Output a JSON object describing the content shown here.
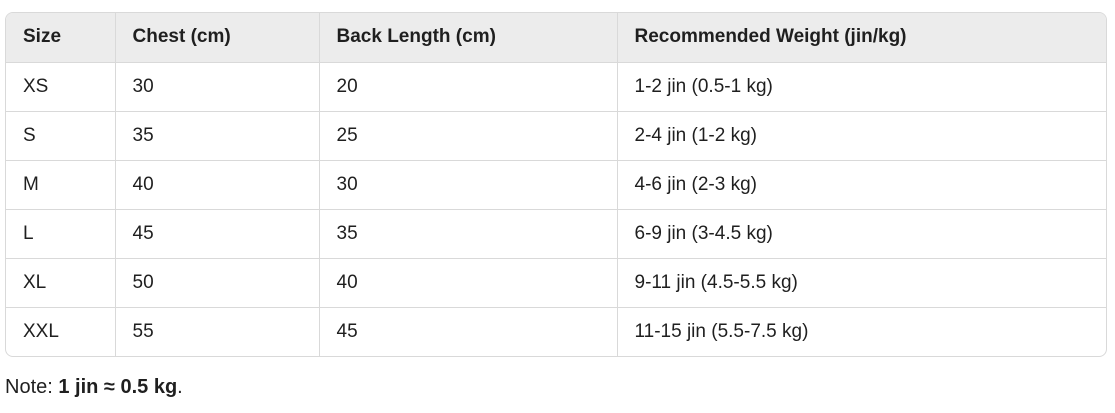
{
  "table": {
    "headers": [
      "Size",
      "Chest (cm)",
      "Back Length (cm)",
      "Recommended Weight (jin/kg)"
    ],
    "rows": [
      [
        "XS",
        "30",
        "20",
        "1-2 jin (0.5-1 kg)"
      ],
      [
        "S",
        "35",
        "25",
        "2-4 jin (1-2 kg)"
      ],
      [
        "M",
        "40",
        "30",
        "4-6 jin (2-3 kg)"
      ],
      [
        "L",
        "45",
        "35",
        "6-9 jin (3-4.5 kg)"
      ],
      [
        "XL",
        "50",
        "40",
        "9-11 jin (4.5-5.5 kg)"
      ],
      [
        "XXL",
        "55",
        "45",
        "11-15 jin (5.5-7.5 kg)"
      ]
    ]
  },
  "note": {
    "prefix": "Note: ",
    "emphasis": "1 jin ≈ 0.5 kg",
    "suffix": "."
  }
}
